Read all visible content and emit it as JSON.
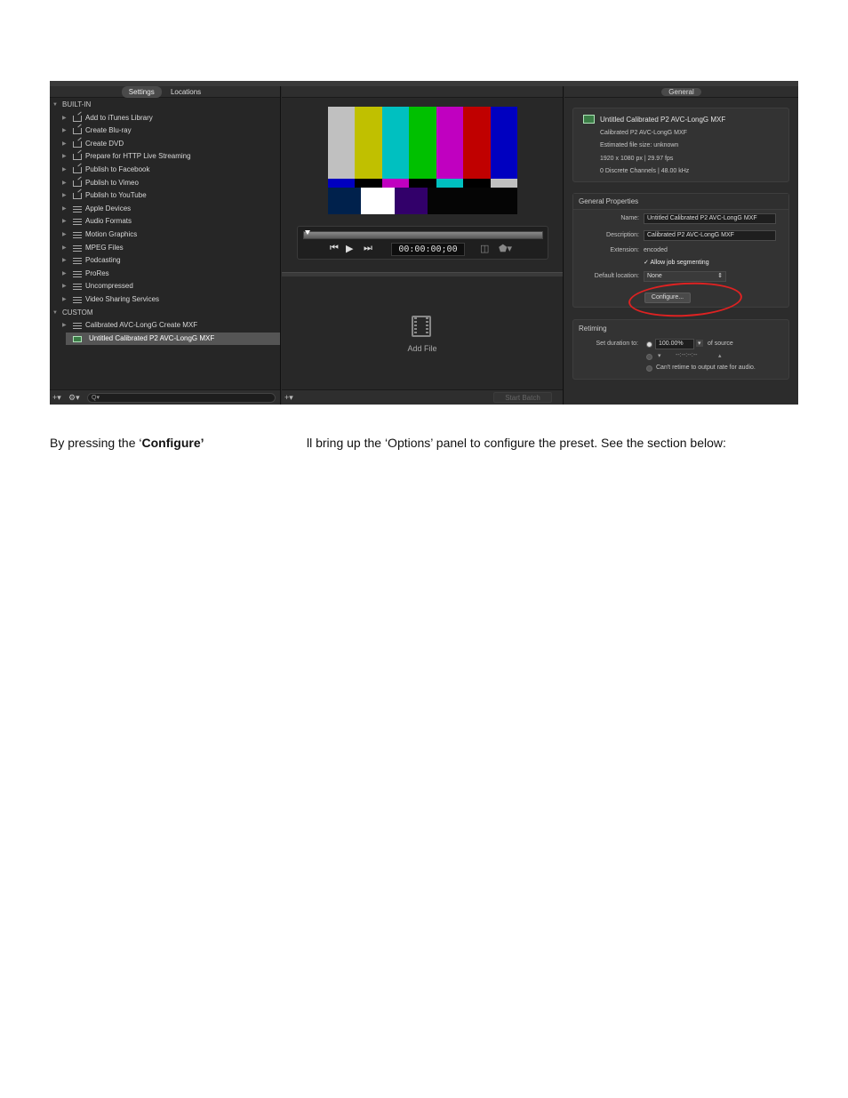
{
  "left_panel": {
    "tabs": [
      "Settings",
      "Locations"
    ],
    "builtin_label": "BUILT-IN",
    "builtin_items": [
      {
        "label": "Add to iTunes Library",
        "icon": "share-icon"
      },
      {
        "label": "Create Blu-ray",
        "icon": "share-icon"
      },
      {
        "label": "Create DVD",
        "icon": "share-icon"
      },
      {
        "label": "Prepare for HTTP Live Streaming",
        "icon": "share-icon"
      },
      {
        "label": "Publish to Facebook",
        "icon": "share-icon"
      },
      {
        "label": "Publish to Vimeo",
        "icon": "share-icon"
      },
      {
        "label": "Publish to YouTube",
        "icon": "share-icon"
      },
      {
        "label": "Apple Devices",
        "icon": "settings-icon"
      },
      {
        "label": "Audio Formats",
        "icon": "settings-icon"
      },
      {
        "label": "Motion Graphics",
        "icon": "settings-icon"
      },
      {
        "label": "MPEG Files",
        "icon": "settings-icon"
      },
      {
        "label": "Podcasting",
        "icon": "settings-icon"
      },
      {
        "label": "ProRes",
        "icon": "settings-icon"
      },
      {
        "label": "Uncompressed",
        "icon": "settings-icon"
      },
      {
        "label": "Video Sharing Services",
        "icon": "settings-icon"
      }
    ],
    "custom_label": "CUSTOM",
    "custom_items": [
      {
        "label": "Calibrated AVC-LongG Create MXF",
        "icon": "settings-icon"
      },
      {
        "label": "Untitled Calibrated P2 AVC-LongG MXF",
        "icon": "preset-icon"
      }
    ],
    "bottom": {
      "add": "+",
      "gear": "⚙",
      "search_placeholder": "Q▾"
    }
  },
  "center_panel": {
    "timecode": "00:00:00;00",
    "add_file": "Add File",
    "start_batch": "Start Batch",
    "add": "+"
  },
  "right_panel": {
    "tab": "General",
    "info": {
      "title": "Untitled Calibrated P2 AVC-LongG MXF",
      "subtitle": "Calibrated P2 AVC-LongG MXF",
      "file_size": "Estimated file size: unknown",
      "resolution": "1920 x 1080 px | 29.97 fps",
      "audio": "0 Discrete Channels | 48.00 kHz"
    },
    "general": {
      "header": "General Properties",
      "name_label": "Name:",
      "name_value": "Untitled Calibrated P2 AVC-LongG MXF",
      "desc_label": "Description:",
      "desc_value": "Calibrated P2 AVC-LongG MXF",
      "ext_label": "Extension:",
      "ext_value": "encoded",
      "segment_label": "Allow job segmenting",
      "location_label": "Default location:",
      "location_value": "None",
      "configure": "Configure..."
    },
    "retiming": {
      "header": "Retiming",
      "set_label": "Set duration to:",
      "percent": "100.00%",
      "of_source": "of source",
      "tc": "--:--:--:--",
      "audio_note": "Can't retime to output rate for audio."
    }
  },
  "caption": {
    "prefix": "By pressing the ‘",
    "bold": "Configure’",
    "suffix": "ll bring up the ‘Options’ panel to configure the preset. See the section below:"
  },
  "colors": {
    "highlight_ring": "#d22222",
    "selection": "#555555"
  }
}
